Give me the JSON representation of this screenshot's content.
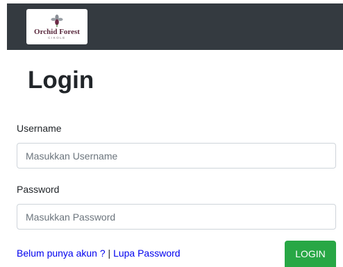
{
  "brand": {
    "name": "Orchid Forest",
    "subtitle": "CIKOLE",
    "logo_icon": "orchid-flower-icon"
  },
  "login": {
    "title": "Login",
    "username_label": "Username",
    "username_placeholder": "Masukkan Username",
    "password_label": "Password",
    "password_placeholder": "Masukkan Password",
    "register_link": "Belum punya akun ?",
    "separator": "|",
    "forgot_link": "Lupa Password",
    "submit_label": "LOGIN"
  },
  "colors": {
    "navbar": "#343a40",
    "submit_button": "#28a745",
    "link": "#0000ee"
  }
}
